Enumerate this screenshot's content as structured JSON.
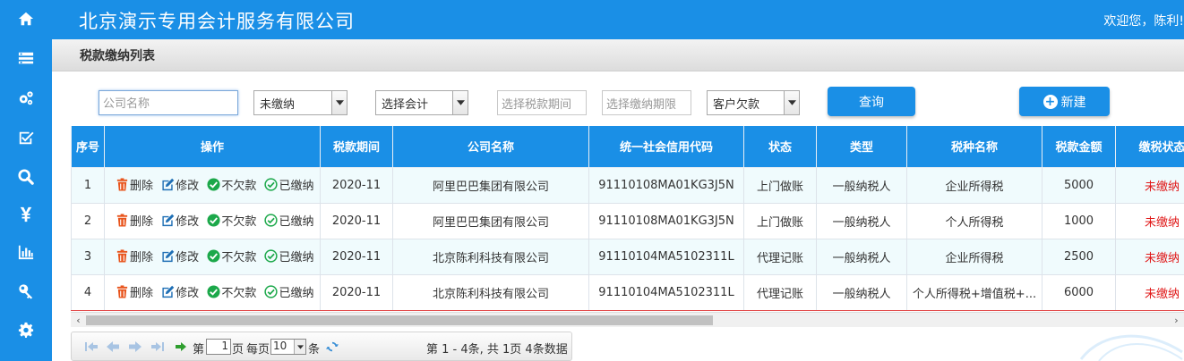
{
  "colors": {
    "primary": "#1a8fe6",
    "unpaid": "#e01919",
    "delete": "#e8541c"
  },
  "sidebar": {
    "icons": [
      "home-icon",
      "list-icon",
      "cogs-icon",
      "check-icon",
      "search-icon",
      "yuan-icon",
      "chart-icon",
      "wrench-icon",
      "gear-icon"
    ]
  },
  "header": {
    "title": "北京演示专用会计服务有限公司",
    "welcome": "欢迎您，陈利!"
  },
  "subbar": {
    "page_title": "税款缴纳列表"
  },
  "filters": {
    "company_placeholder": "公司名称",
    "payment_status": "未缴纳",
    "accountant": "选择会计",
    "tax_period_placeholder": "选择税款期间",
    "payment_deadline_placeholder": "选择缴纳期限",
    "customer_debt": "客户欠款",
    "search_label": "查询",
    "new_label": "新建"
  },
  "table": {
    "headers": [
      "序号",
      "操作",
      "税款期间",
      "公司名称",
      "统一社会信用代码",
      "状态",
      "类型",
      "税种名称",
      "税款金额",
      "缴税状态"
    ],
    "actions": {
      "delete": "删除",
      "edit": "修改",
      "no_debt": "不欠款",
      "paid": "已缴纳"
    },
    "rows": [
      {
        "no": "1",
        "period": "2020-11",
        "company": "阿里巴巴集团有限公司",
        "credit_code": "91110108MA01KG3J5N",
        "status": "上门做账",
        "type": "一般纳税人",
        "tax_name": "企业所得税",
        "amount": "5000",
        "pay_status": "未缴纳"
      },
      {
        "no": "2",
        "period": "2020-11",
        "company": "阿里巴巴集团有限公司",
        "credit_code": "91110108MA01KG3J5N",
        "status": "上门做账",
        "type": "一般纳税人",
        "tax_name": "个人所得税",
        "amount": "1000",
        "pay_status": "未缴纳"
      },
      {
        "no": "3",
        "period": "2020-11",
        "company": "北京陈利科技有限公司",
        "credit_code": "91110104MA5102311L",
        "status": "代理记账",
        "type": "一般纳税人",
        "tax_name": "企业所得税",
        "amount": "2500",
        "pay_status": "未缴纳"
      },
      {
        "no": "4",
        "period": "2020-11",
        "company": "北京陈利科技有限公司",
        "credit_code": "91110104MA5102311L",
        "status": "代理记账",
        "type": "一般纳税人",
        "tax_name": "个人所得税+增值税+...",
        "amount": "6000",
        "pay_status": "未缴纳"
      }
    ]
  },
  "pager": {
    "page_prefix": "第",
    "current_page": "1",
    "page_suffix": "页",
    "per_page_label": "每页",
    "page_size": "10",
    "per_page_suffix": "条",
    "summary": "第 1 - 4条, 共 1页 4条数据"
  }
}
